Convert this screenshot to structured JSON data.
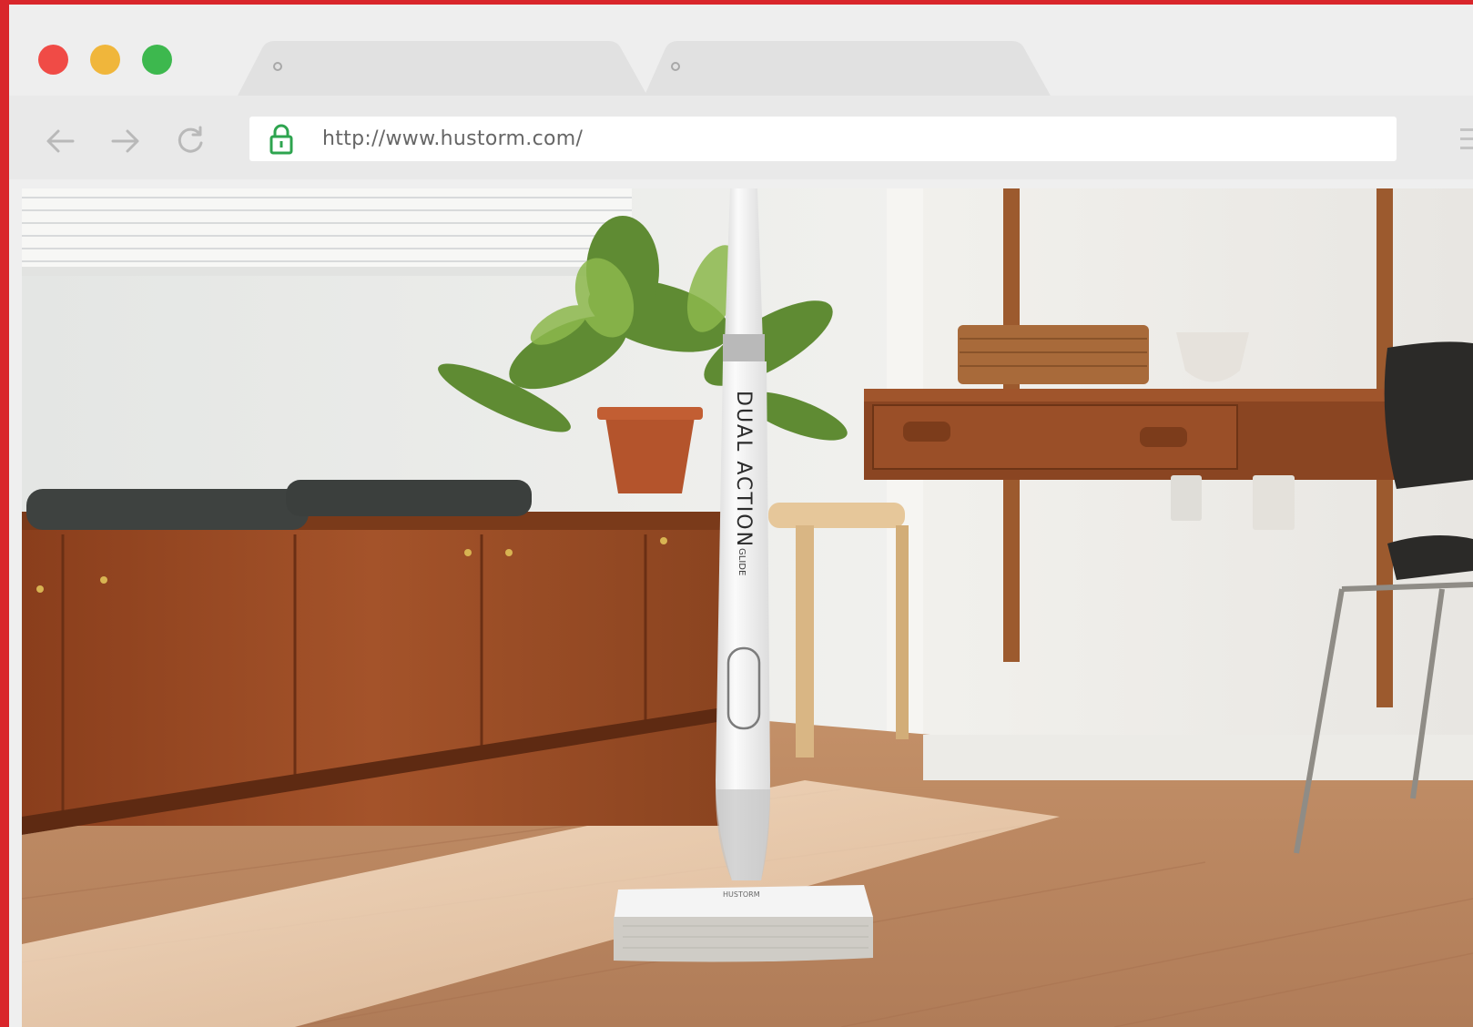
{
  "browser": {
    "window_controls": [
      {
        "name": "close",
        "color": "#f04b46"
      },
      {
        "name": "minimize",
        "color": "#f0b63b"
      },
      {
        "name": "zoom",
        "color": "#3db84e"
      }
    ],
    "tabs": [
      {
        "label": "",
        "active": false
      },
      {
        "label": "",
        "active": false
      }
    ],
    "nav": {
      "back_icon": "arrow-left-icon",
      "forward_icon": "arrow-right-icon",
      "reload_icon": "reload-icon"
    },
    "address_bar": {
      "lock_icon": "lock-icon",
      "lock_color": "#2ea44f",
      "url": "http://www.hustorm.com/"
    },
    "menu_icon": "hamburger-menu-icon",
    "frame_color": "#d9262b"
  },
  "page": {
    "hero_image": "photo of a white cordless wet mop standing on a wooden floor in a sunlit room",
    "product_handle_text": "DUAL ACTION",
    "product_handle_subtext": "GLIDE",
    "product_head_text": "HUSTORM"
  }
}
